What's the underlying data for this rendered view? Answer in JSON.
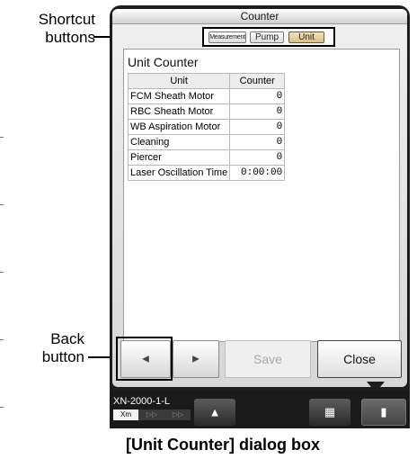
{
  "callouts": {
    "shortcut_line1": "Shortcut",
    "shortcut_line2": "buttons",
    "back_line1": "Back",
    "back_line2": "button"
  },
  "dialog": {
    "title": "Counter",
    "shortcut_buttons": [
      "Measurement",
      "Pump",
      "Unit"
    ],
    "active_shortcut": "Unit",
    "content_title": "Unit Counter",
    "table": {
      "headers": [
        "Unit",
        "Counter"
      ],
      "rows": [
        [
          "FCM Sheath Motor",
          "0"
        ],
        [
          "RBC Sheath Motor",
          "0"
        ],
        [
          "WB Aspiration Motor",
          "0"
        ],
        [
          "Cleaning",
          "0"
        ],
        [
          "Piercer",
          "0"
        ],
        [
          "Laser Oscillation Time",
          "0:00:00"
        ]
      ]
    },
    "buttons": {
      "save_label": "Save",
      "close_label": "Close"
    }
  },
  "taskbar": {
    "model": "XN-2000-1-L",
    "mode_labels": [
      "Xm",
      "▷▷",
      "▷▷"
    ],
    "warning_icon": "warning-icon",
    "buttons": [
      "warning-icon",
      "rack-icon",
      "sampler-icon"
    ]
  },
  "caption": "[Unit Counter] dialog box",
  "colors": {
    "taskbar": "#1a1a1a",
    "active_shortcut": "#d9bf88",
    "dialog_bg": "#e4e4e4"
  }
}
